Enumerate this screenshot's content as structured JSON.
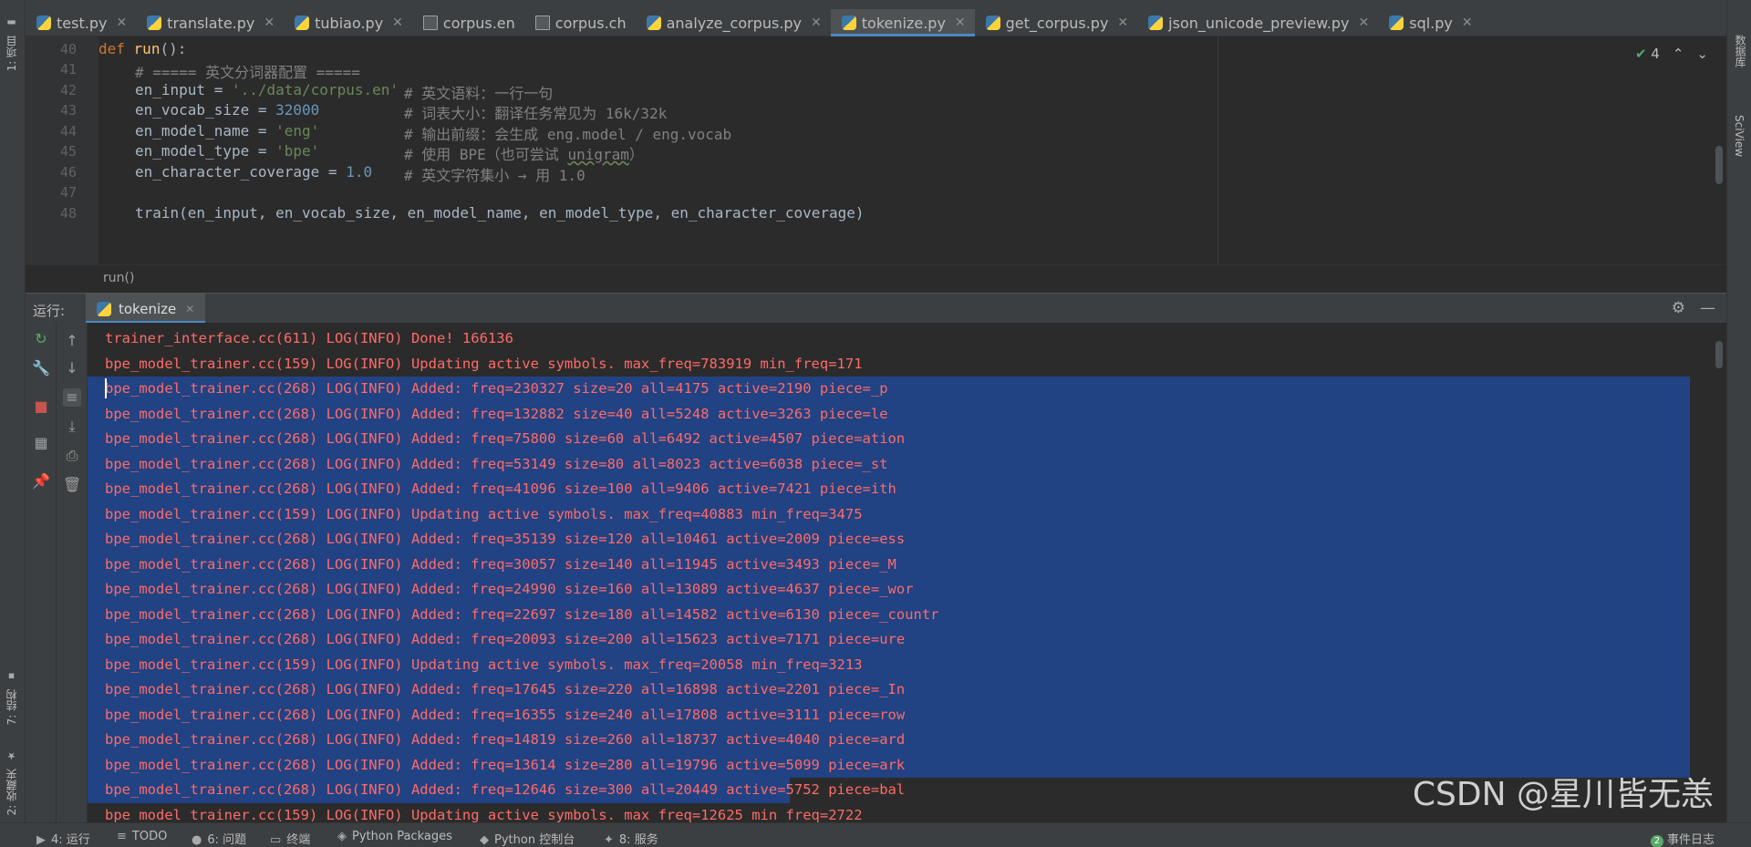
{
  "left_tools": {
    "project": "1: 项目",
    "structure": "7: 结构",
    "favorites": "2: 收藏夹"
  },
  "right_tools": {
    "database": "数据库",
    "sciview": "SciView"
  },
  "tabs": [
    {
      "label": "test.py",
      "icon": "python-file-icon"
    },
    {
      "label": "translate.py",
      "icon": "python-file-icon"
    },
    {
      "label": "tubiao.py",
      "icon": "python-file-icon"
    },
    {
      "label": "corpus.en",
      "icon": "text-file-icon"
    },
    {
      "label": "corpus.ch",
      "icon": "text-file-icon"
    },
    {
      "label": "analyze_corpus.py",
      "icon": "python-file-icon"
    },
    {
      "label": "tokenize.py",
      "icon": "python-file-icon",
      "active": true
    },
    {
      "label": "get_corpus.py",
      "icon": "python-file-icon"
    },
    {
      "label": "json_unicode_preview.py",
      "icon": "python-file-icon"
    },
    {
      "label": "sql.py",
      "icon": "python-file-icon"
    }
  ],
  "editor": {
    "line_numbers": [
      "40",
      "41",
      "42",
      "43",
      "44",
      "45",
      "46",
      "47",
      "48"
    ],
    "lines": {
      "l40": {
        "kw": "def",
        "fn": "run",
        "rest": "():"
      },
      "l41": {
        "comment": "# ===== 英文分词器配置 ====="
      },
      "l42": {
        "code": "en_input = ",
        "str": "'../data/corpus.en'",
        "comment": "# 英文语料：一行一句"
      },
      "l43": {
        "code": "en_vocab_size = ",
        "num": "32000",
        "comment": "# 词表大小：翻译任务常见为 16k/32k"
      },
      "l44": {
        "code": "en_model_name = ",
        "str": "'eng'",
        "comment": "# 输出前缀：会生成 eng.model / eng.vocab"
      },
      "l45": {
        "code": "en_model_type = ",
        "str": "'bpe'",
        "comment_a": "# 使用 BPE（也可尝试 ",
        "comment_warn": "unigram",
        "comment_b": "）"
      },
      "l46": {
        "code": "en_character_coverage = ",
        "num": "1.0",
        "comment": "# 英文字符集小 → 用 1.0"
      },
      "l48": {
        "code": "train(en_input, en_vocab_size, en_model_name, en_model_type, en_character_coverage)"
      }
    },
    "inspection_count": "4",
    "breadcrumb": "run()"
  },
  "run_panel": {
    "label": "运行:",
    "tab": "tokenize"
  },
  "console": {
    "lines": [
      {
        "text": "trainer_interface.cc(611) LOG(INFO) Done! 166136",
        "selected": false
      },
      {
        "text": "bpe_model_trainer.cc(159) LOG(INFO) Updating active symbols. max_freq=783919 min_freq=171",
        "selected": false
      },
      {
        "text": "bpe_model_trainer.cc(268) LOG(INFO) Added: freq=230327 size=20 all=4175 active=2190 piece=_p",
        "selected": true
      },
      {
        "text": "bpe_model_trainer.cc(268) LOG(INFO) Added: freq=132882 size=40 all=5248 active=3263 piece=le",
        "selected": true
      },
      {
        "text": "bpe_model_trainer.cc(268) LOG(INFO) Added: freq=75800 size=60 all=6492 active=4507 piece=ation",
        "selected": true
      },
      {
        "text": "bpe_model_trainer.cc(268) LOG(INFO) Added: freq=53149 size=80 all=8023 active=6038 piece=_st",
        "selected": true
      },
      {
        "text": "bpe_model_trainer.cc(268) LOG(INFO) Added: freq=41096 size=100 all=9406 active=7421 piece=ith",
        "selected": true
      },
      {
        "text": "bpe_model_trainer.cc(159) LOG(INFO) Updating active symbols. max_freq=40883 min_freq=3475",
        "selected": true
      },
      {
        "text": "bpe_model_trainer.cc(268) LOG(INFO) Added: freq=35139 size=120 all=10461 active=2009 piece=ess",
        "selected": true
      },
      {
        "text": "bpe_model_trainer.cc(268) LOG(INFO) Added: freq=30057 size=140 all=11945 active=3493 piece=_M",
        "selected": true
      },
      {
        "text": "bpe_model_trainer.cc(268) LOG(INFO) Added: freq=24990 size=160 all=13089 active=4637 piece=_wor",
        "selected": true
      },
      {
        "text": "bpe_model_trainer.cc(268) LOG(INFO) Added: freq=22697 size=180 all=14582 active=6130 piece=_countr",
        "selected": true
      },
      {
        "text": "bpe_model_trainer.cc(268) LOG(INFO) Added: freq=20093 size=200 all=15623 active=7171 piece=ure",
        "selected": true
      },
      {
        "text": "bpe_model_trainer.cc(159) LOG(INFO) Updating active symbols. max_freq=20058 min_freq=3213",
        "selected": true
      },
      {
        "text": "bpe_model_trainer.cc(268) LOG(INFO) Added: freq=17645 size=220 all=16898 active=2201 piece=_In",
        "selected": true
      },
      {
        "text": "bpe_model_trainer.cc(268) LOG(INFO) Added: freq=16355 size=240 all=17808 active=3111 piece=row",
        "selected": true
      },
      {
        "text": "bpe_model_trainer.cc(268) LOG(INFO) Added: freq=14819 size=260 all=18737 active=4040 piece=ard",
        "selected": true
      },
      {
        "text": "bpe_model_trainer.cc(268) LOG(INFO) Added: freq=13614 size=280 all=19796 active=5099 piece=ark",
        "selected": true
      },
      {
        "text": "bpe_model_trainer.cc(268) LOG(INFO) Added: freq=12646 size=300 all=20449 active=5752 piece=bal",
        "selected": true
      },
      {
        "text": "bpe_model_trainer.cc(159) LOG(INFO) Updating active symbols. max_freq=12625 min_freq=2722",
        "selected": false
      }
    ],
    "watermark": "CSDN @星川皆无恙"
  },
  "bottom_bar": {
    "run": "4: 运行",
    "todo": "TODO",
    "problems": "6: 问题",
    "terminal": "终端",
    "python_packages": "Python Packages",
    "python_console": "Python 控制台",
    "services": "8: 服务",
    "event_count": "2",
    "event_log": "事件日志"
  },
  "colors": {
    "selection": "#214283",
    "log_text": "#ff6b68",
    "accent": "#4a88c7"
  }
}
